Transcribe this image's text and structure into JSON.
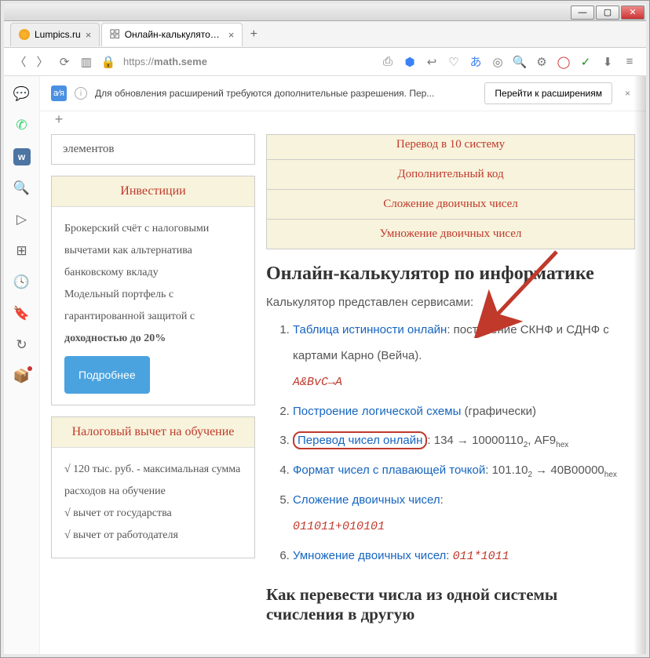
{
  "window": {
    "min": "—",
    "max": "▢",
    "close": "✕"
  },
  "tabs": {
    "t1": {
      "title": "Lumpics.ru",
      "fav_color": "#f39c12"
    },
    "t2": {
      "title": "Онлайн-калькулятор по и"
    },
    "close": "×",
    "plus": "+"
  },
  "address": {
    "url_proto": "https://",
    "url_host": "math.seme"
  },
  "notification": {
    "text": "Для обновления расширений требуются дополнительные разрешения. Пер...",
    "button": "Перейти к расширениям",
    "close": "×"
  },
  "sidebar": {
    "element_tail": "элементов",
    "card1": {
      "title": "Инвестиции",
      "body_a": "Брокерский счёт с налоговыми вычетами как альтернатива банковскому вкладу",
      "body_b": "Модельный портфель с гарантированной защитой с ",
      "body_b_bold": "доходностью до 20%",
      "more": "Подробнее"
    },
    "card2": {
      "title": "Налоговый вычет на обучение",
      "l1": "√ 120 тыс. руб. - максимальная сумма расходов на обучение",
      "l2": "√ вычет от государства",
      "l3": "√ вычет от работодателя"
    }
  },
  "toplinks": {
    "i0": "Перевод в 10 систему",
    "i1": "Дополнительный код",
    "i2": "Сложение двоичных чисел",
    "i3": "Умножение двоичных чисел"
  },
  "main": {
    "heading": "Онлайн-калькулятор по информатике",
    "intro": "Калькулятор представлен сервисами:",
    "s1_link": "Таблица истинности онлайн",
    "s1_tail": ": построение СКНФ и СДНФ с картами Карно (Вейча).",
    "s1_code": "A&BvC→A",
    "s2_link": "Построение логической схемы",
    "s2_tail": " (графически)",
    "s3_link": "Перевод чисел онлайн",
    "s3_tail_a": ": 134 → 10000110",
    "s3_tail_b": ", AF9",
    "s3_sub1": "2",
    "s3_sub2": "hex",
    "s4_link": "Формат чисел с плавающей точкой",
    "s4_tail_a": ": 101.10",
    "s4_tail_b": " → 40B00000",
    "s4_sub1": "2",
    "s4_sub2": "hex",
    "s5_link": "Сложение двоичных чисел",
    "s5_tail": ":",
    "s5_code": "011011+010101",
    "s6_link": "Умножение двоичных чисел",
    "s6_tail": ": ",
    "s6_code": "011*1011",
    "heading2": "Как перевести числа из одной системы счисления в другую"
  }
}
